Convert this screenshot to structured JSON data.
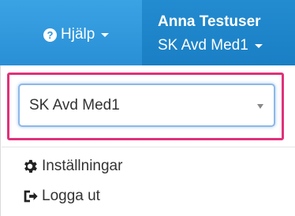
{
  "header": {
    "help_label": "Hjälp",
    "user_name": "Anna Testuser",
    "user_unit": "SK Avd Med1"
  },
  "menu": {
    "unit_select": {
      "selected": "SK Avd Med1"
    },
    "items": [
      {
        "label": "Inställningar",
        "icon": "gear-icon"
      },
      {
        "label": "Logga ut",
        "icon": "logout-icon"
      }
    ]
  },
  "colors": {
    "header_blue": "#2f96dc",
    "user_blue": "#1f86cb",
    "highlight": "#e0317a",
    "focus": "#8db8e8"
  }
}
